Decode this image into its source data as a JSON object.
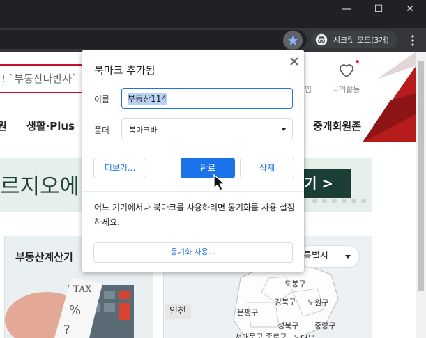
{
  "window": {
    "minimize_glyph": "—",
    "maximize_glyph": "☐",
    "close_glyph": "✕"
  },
  "toolbar": {
    "incognito_label": "시크릿 모드(3개)",
    "star_color": "#8ab4f8"
  },
  "page": {
    "search_text": "! `부동산다반사`",
    "login_label": "입",
    "mypage_label": "나의활동",
    "nav": [
      "원",
      "생활·Plus",
      "중개회원존"
    ],
    "banner_text": "르지오에 신",
    "banner_button": "기 >",
    "calc_title": "부동산계산기",
    "map_select": "특별시",
    "map_labels": {
      "incheon": "인천",
      "dobong": "도봉구",
      "gangbuk": "강북구",
      "nowon": "노원구",
      "eunpyeong": "은평구",
      "seongbuk": "성북구",
      "jungnang": "중랑구",
      "seodaemun_jongno": "서대문구 종로구",
      "dongdaemun": "동대문"
    },
    "calc_tax_text": "TAX"
  },
  "bookmark": {
    "title": "북마크 추가됨",
    "name_label": "이름",
    "name_value": "부동산114",
    "folder_label": "폴더",
    "folder_value": "북마크바",
    "more_button": "더보기...",
    "done_button": "완료",
    "delete_button": "삭제",
    "sync_message": "어느 기기에서나 북마크를 사용하려면 동기화를 사용 설정하세요.",
    "sync_button": "동기화 사용...",
    "accent_color": "#1a73e8"
  }
}
